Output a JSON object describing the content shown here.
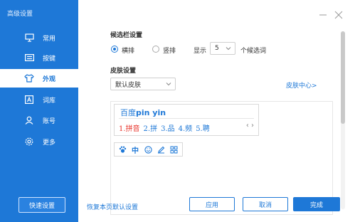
{
  "sidebar": {
    "title": "高级设置",
    "items": [
      {
        "label": "常用",
        "icon": "monitor-icon"
      },
      {
        "label": "按键",
        "icon": "keyboard-icon"
      },
      {
        "label": "外观",
        "icon": "shirt-icon",
        "active": true
      },
      {
        "label": "词库",
        "icon": "dictionary-icon"
      },
      {
        "label": "账号",
        "icon": "user-icon"
      },
      {
        "label": "更多",
        "icon": "gear-icon"
      }
    ],
    "quick_settings_label": "快速设置"
  },
  "candidate_bar": {
    "title": "候选栏设置",
    "orientation_options": [
      "横排",
      "竖排"
    ],
    "selected_orientation": "横排",
    "show_label": "显示",
    "count_value": "5",
    "count_suffix": "个候选词"
  },
  "skin": {
    "title": "皮肤设置",
    "selected": "默认皮肤",
    "center_link": "皮肤中心>"
  },
  "preview": {
    "input_prefix": "百度",
    "input_pinyin": "pin yin",
    "candidates": [
      "1.拼音",
      "2.拼",
      "3.品",
      "4.频",
      "5.聘"
    ],
    "nav": "‹ ›",
    "toolbar": {
      "zh_label": "中"
    }
  },
  "footer": {
    "restore_link": "恢复本页默认设置",
    "apply_label": "应用",
    "cancel_label": "取消",
    "done_label": "完成"
  },
  "colors": {
    "accent": "#1e78d7",
    "candidate_highlight": "#e8362d"
  }
}
